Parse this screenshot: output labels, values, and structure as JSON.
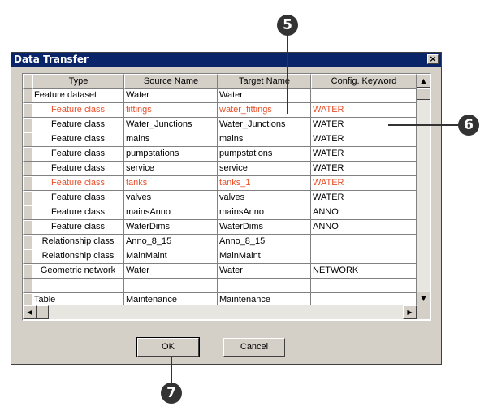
{
  "dialog": {
    "title": "Data Transfer",
    "close_glyph": "×",
    "ok_label": "OK",
    "cancel_label": "Cancel"
  },
  "table": {
    "columns": [
      "Type",
      "Source Name",
      "Target Name",
      "Config. Keyword"
    ],
    "rows": [
      {
        "type": "Feature dataset",
        "source": "Water",
        "target": "Water",
        "keyword": "",
        "highlight": false
      },
      {
        "type": "Feature class",
        "source": "fittings",
        "target": "water_fittings",
        "keyword": "WATER",
        "highlight": true
      },
      {
        "type": "Feature class",
        "source": "Water_Junctions",
        "target": "Water_Junctions",
        "keyword": "WATER",
        "highlight": false
      },
      {
        "type": "Feature class",
        "source": "mains",
        "target": "mains",
        "keyword": "WATER",
        "highlight": false
      },
      {
        "type": "Feature class",
        "source": "pumpstations",
        "target": "pumpstations",
        "keyword": "WATER",
        "highlight": false
      },
      {
        "type": "Feature class",
        "source": "service",
        "target": "service",
        "keyword": "WATER",
        "highlight": false
      },
      {
        "type": "Feature class",
        "source": "tanks",
        "target": "tanks_1",
        "keyword": "WATER",
        "highlight": true
      },
      {
        "type": "Feature class",
        "source": "valves",
        "target": "valves",
        "keyword": "WATER",
        "highlight": false
      },
      {
        "type": "Feature class",
        "source": "mainsAnno",
        "target": "mainsAnno",
        "keyword": "ANNO",
        "highlight": false
      },
      {
        "type": "Feature class",
        "source": "WaterDims",
        "target": "WaterDims",
        "keyword": "ANNO",
        "highlight": false
      },
      {
        "type": "Relationship class",
        "source": "Anno_8_15",
        "target": "Anno_8_15",
        "keyword": "",
        "highlight": false
      },
      {
        "type": "Relationship class",
        "source": "MainMaint",
        "target": "MainMaint",
        "keyword": "",
        "highlight": false
      },
      {
        "type": "Geometric network",
        "source": "Water",
        "target": "Water",
        "keyword": "NETWORK",
        "highlight": false
      },
      {
        "type": "",
        "source": "",
        "target": "",
        "keyword": "",
        "highlight": false
      },
      {
        "type": "Table",
        "source": "Maintenance",
        "target": "Maintenance",
        "keyword": "",
        "highlight": false
      }
    ]
  },
  "callouts": {
    "c5": "5",
    "c6": "6",
    "c7": "7"
  },
  "colors": {
    "title_bar": "#0a246a",
    "highlight_text": "#e8502a",
    "dialog_bg": "#d4d0c8"
  }
}
